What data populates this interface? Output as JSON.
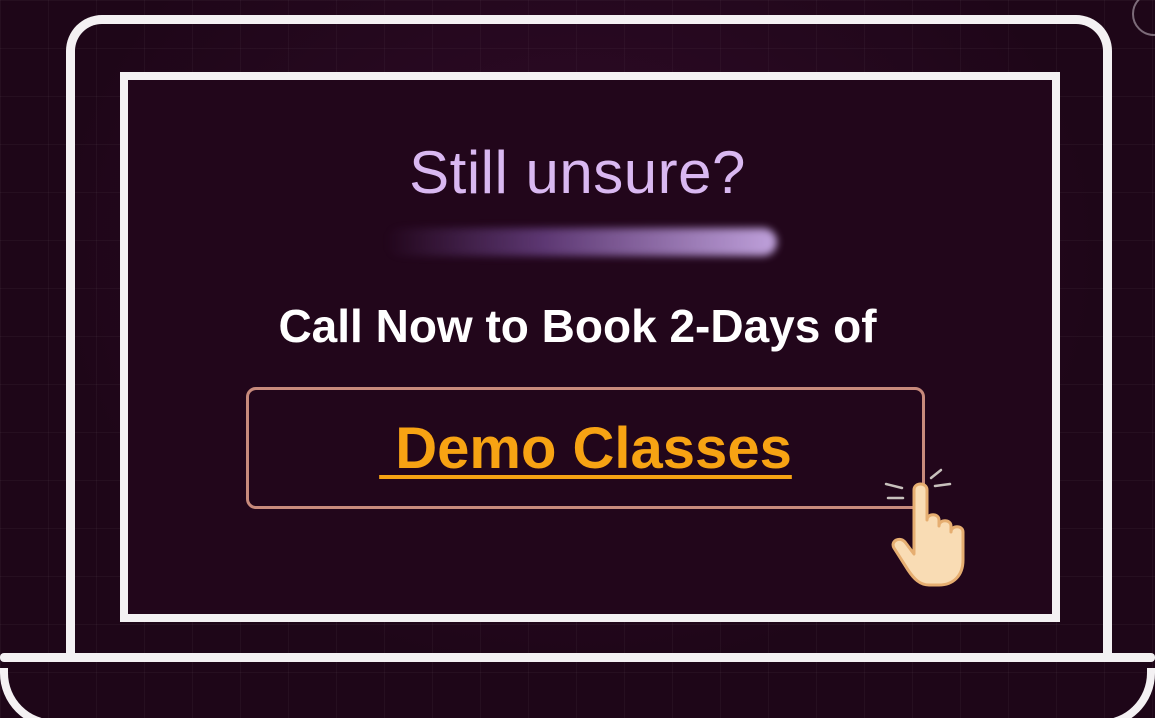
{
  "promo": {
    "headline": "Still unsure?",
    "subline": "Call Now to Book 2-Days of",
    "cta_label": " Demo Classes"
  },
  "icons": {
    "cursor": "pointer-hand-icon"
  },
  "colors": {
    "background": "#1e0618",
    "outline": "#f4f1f3",
    "headline": "#d9b8f1",
    "subline": "#ffffff",
    "cta_text": "#f7a313",
    "cta_border": "#c88a7c",
    "cursor_fill": "#f9dcb4"
  }
}
